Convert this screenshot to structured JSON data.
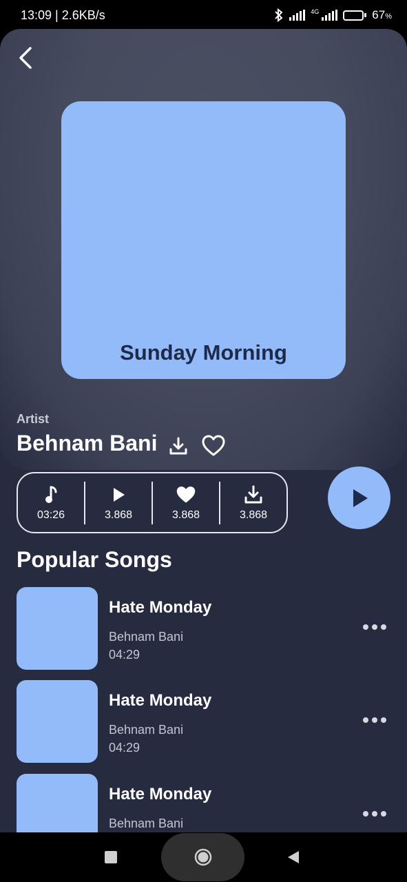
{
  "status_bar": {
    "time_speed": "13:09 | 2.6KB/s",
    "network_label": "4G",
    "battery_level": 0.67,
    "battery_text": "67",
    "battery_unit": "%"
  },
  "now_playing": {
    "cover_title": "Sunday Morning",
    "artist_label": "Artist",
    "artist_name": "Behnam Bani"
  },
  "stats": [
    {
      "icon": "music-note-icon",
      "value": "03:26"
    },
    {
      "icon": "play-icon",
      "value": "3.868"
    },
    {
      "icon": "heart-filled-icon",
      "value": "3.868"
    },
    {
      "icon": "download-icon",
      "value": "3.868"
    }
  ],
  "popular": {
    "title": "Popular Songs",
    "songs": [
      {
        "title": "Hate Monday",
        "artist": "Behnam Bani",
        "duration": "04:29"
      },
      {
        "title": "Hate Monday",
        "artist": "Behnam Bani",
        "duration": "04:29"
      },
      {
        "title": "Hate Monday",
        "artist": "Behnam Bani",
        "duration": ""
      }
    ]
  },
  "colors": {
    "accent": "#93bbfa",
    "background": "#262b40",
    "hero": "#464b5e",
    "cover_text": "#1e2a4a"
  }
}
